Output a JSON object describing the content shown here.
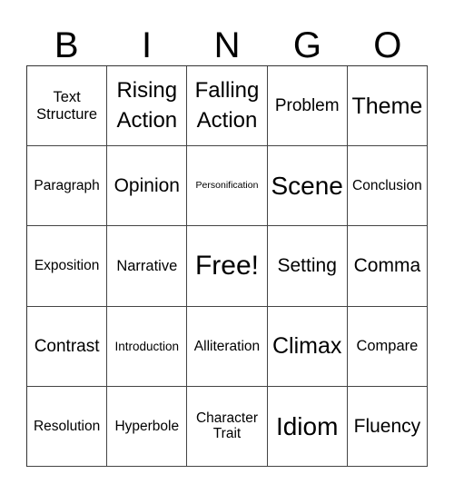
{
  "header": [
    "B",
    "I",
    "N",
    "G",
    "O"
  ],
  "cells": [
    [
      "Text Structure",
      "Rising Action",
      "Falling Action",
      "Problem",
      "Theme"
    ],
    [
      "Paragraph",
      "Opinion",
      "Personification",
      "Scene",
      "Conclusion"
    ],
    [
      "Exposition",
      "Narrative",
      "Free!",
      "Setting",
      "Comma"
    ],
    [
      "Contrast",
      "Introduction",
      "Alliteration",
      "Climax",
      "Compare"
    ],
    [
      "Resolution",
      "Hyperbole",
      "Character Trait",
      "Idiom",
      "Fluency"
    ]
  ]
}
